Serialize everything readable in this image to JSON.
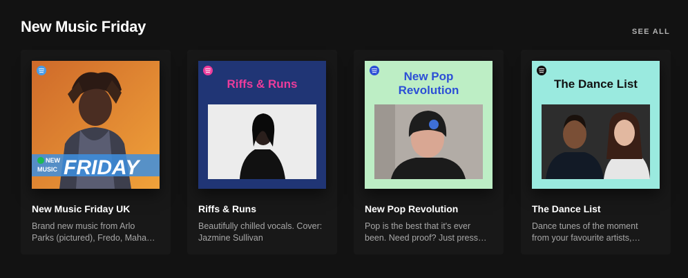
{
  "shelf": {
    "title": "New Music Friday",
    "see_all_label": "SEE ALL"
  },
  "cards": [
    {
      "title": "New Music Friday UK",
      "description": "Brand new music from Arlo Parks (pictured), Fredo, Mahalia and more.",
      "cover_logo_line1": "NEW",
      "cover_logo_line2": "MUSIC",
      "cover_logo_word": "FRIDAY",
      "cover_background": "#e9892e",
      "cover_accent": "#4a9be6"
    },
    {
      "title": "Riffs & Runs",
      "description": "Beautifully chilled vocals. Cover: Jazmine Sullivan",
      "cover_title": "Riffs & Runs",
      "cover_background": "#203575",
      "cover_accent": "#ec3c9b"
    },
    {
      "title": "New Pop Revolution",
      "description": "Pop is the best that it's ever been. Need proof? Just press play.",
      "cover_title_line1": "New Pop",
      "cover_title_line2": "Revolution",
      "cover_background": "#bdeec5",
      "cover_accent": "#2c4fd6"
    },
    {
      "title": "The Dance List",
      "description": "Dance tunes of the moment from your favourite artists, updated weekly.",
      "cover_title": "The Dance List",
      "cover_background": "#9aeadf",
      "cover_accent": "#111111"
    }
  ]
}
